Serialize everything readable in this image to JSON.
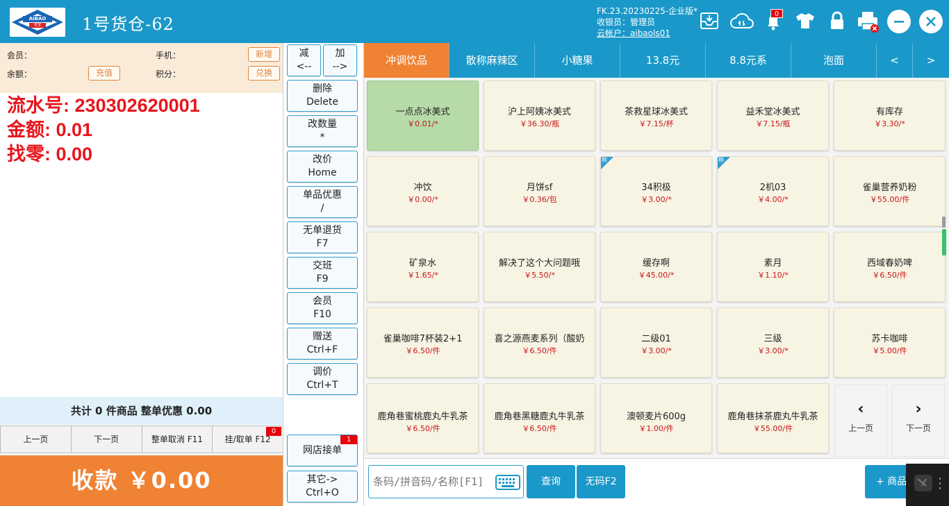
{
  "header": {
    "logo_text": "AIBAO",
    "logo_sub": "爱宝",
    "store_title": "1号货仓-62",
    "version": "FK.23.20230225-企业版*",
    "cashier": "收银员：管理员",
    "cloud_account": "云帐户：aibaols01",
    "notification_count": "0"
  },
  "member": {
    "member_label": "会员：",
    "phone_label": "手机：",
    "balance_label": "余额：",
    "points_label": "积分：",
    "add_button": "新增",
    "recharge_button": "充值",
    "redeem_button": "兑换"
  },
  "transaction": {
    "serial": "流水号: 230302620001",
    "amount": "金额: 0.01",
    "change": "找零: 0.00"
  },
  "summary": "共计 0 件商品 整单优惠 0.00",
  "pagebar": {
    "prev": "上一页",
    "next": "下一页",
    "cancel_order": "整单取消 F11",
    "hold_order": "挂/取单 F12",
    "hold_count": "0"
  },
  "pay_button": "收款    ￥0.00",
  "functions": {
    "minus_top": "减",
    "minus_bottom": "<--",
    "plus_top": "加",
    "plus_bottom": "-->",
    "delete_top": "删除",
    "delete_bottom": "Delete",
    "qty_top": "改数量",
    "qty_bottom": "*",
    "price_top": "改价",
    "price_bottom": "Home",
    "item_disc_top": "单品优惠",
    "item_disc_bottom": "/",
    "return_top": "无单退货",
    "return_bottom": "F7",
    "shift_top": "交班",
    "shift_bottom": "F9",
    "member_top": "会员",
    "member_bottom": "F10",
    "gift_top": "赠送",
    "gift_bottom": "Ctrl+F",
    "adjust_top": "调价",
    "adjust_bottom": "Ctrl+T",
    "online_orders": "网店接单",
    "online_count": "1",
    "other_top": "其它->",
    "other_bottom": "Ctrl+O"
  },
  "categories": [
    "冲调饮品",
    "散称麻辣区",
    "小糖果",
    "13.8元",
    "8.8元系",
    "泡面",
    "<",
    ">"
  ],
  "products": [
    {
      "name": "一点点冰美式",
      "price": "￥0.01/*"
    },
    {
      "name": "沪上阿姨冰美式",
      "price": "￥36.30/瓶"
    },
    {
      "name": "茶救星球冰美式",
      "price": "￥7.15/杯"
    },
    {
      "name": "益禾堂冰美式",
      "price": "￥7.15/瓶"
    },
    {
      "name": "有库存",
      "price": "￥3.30/*"
    },
    {
      "name": "冲饮",
      "price": "￥0.00/*"
    },
    {
      "name": "月饼sf",
      "price": "￥0.36/包"
    },
    {
      "name": "34积极",
      "price": "￥3.00/*"
    },
    {
      "name": "2机03",
      "price": "￥4.00/*"
    },
    {
      "name": "雀巢营养奶粉",
      "price": "￥55.00/件"
    },
    {
      "name": "矿泉水",
      "price": "￥1.65/*"
    },
    {
      "name": "解决了这个大问题哦",
      "price": "￥5.50/*"
    },
    {
      "name": "缓存啊",
      "price": "￥45.00/*"
    },
    {
      "name": "素月",
      "price": "￥1.10/*"
    },
    {
      "name": "西域春奶啤",
      "price": "￥6.50/件"
    },
    {
      "name": "雀巢咖啡7杯装2+1",
      "price": "￥6.50/件"
    },
    {
      "name": "喜之源燕麦系列（酸奶",
      "price": "￥6.50/件"
    },
    {
      "name": "二级01",
      "price": "￥3.00/*"
    },
    {
      "name": "三级",
      "price": "￥3.00/*"
    },
    {
      "name": "苏卡咖啡",
      "price": "￥5.00/件"
    },
    {
      "name": "鹿角巷蜜桃鹿丸牛乳茶",
      "price": "￥6.50/件"
    },
    {
      "name": "鹿角巷黑糖鹿丸牛乳茶",
      "price": "￥6.50/件"
    },
    {
      "name": "澳顿麦片600g",
      "price": "￥1.00/件"
    },
    {
      "name": "鹿角巷抹茶鹿丸牛乳茶",
      "price": "￥55.00/件"
    }
  ],
  "weighed_tag": "称",
  "grid_nav": {
    "prev": "上一页",
    "next": "下一页",
    "prev_arrow": "‹",
    "next_arrow": "›"
  },
  "bottom": {
    "search_placeholder": "条码/拼音码/名称[F1]",
    "query_button": "查询",
    "no_code_button": "无码F2",
    "add_product_button": "+ 商品"
  },
  "colors": {
    "header_blue": "#1a98c9",
    "accent_orange": "#f08233",
    "alert_red": "#e8151c",
    "selected_green": "#b6dba9"
  },
  "icons": [
    "scan-icon",
    "cloud-sync-icon",
    "bell-icon",
    "shirt-icon",
    "lock-icon",
    "printer-icon",
    "minimize-icon",
    "close-icon",
    "keyboard-icon"
  ]
}
